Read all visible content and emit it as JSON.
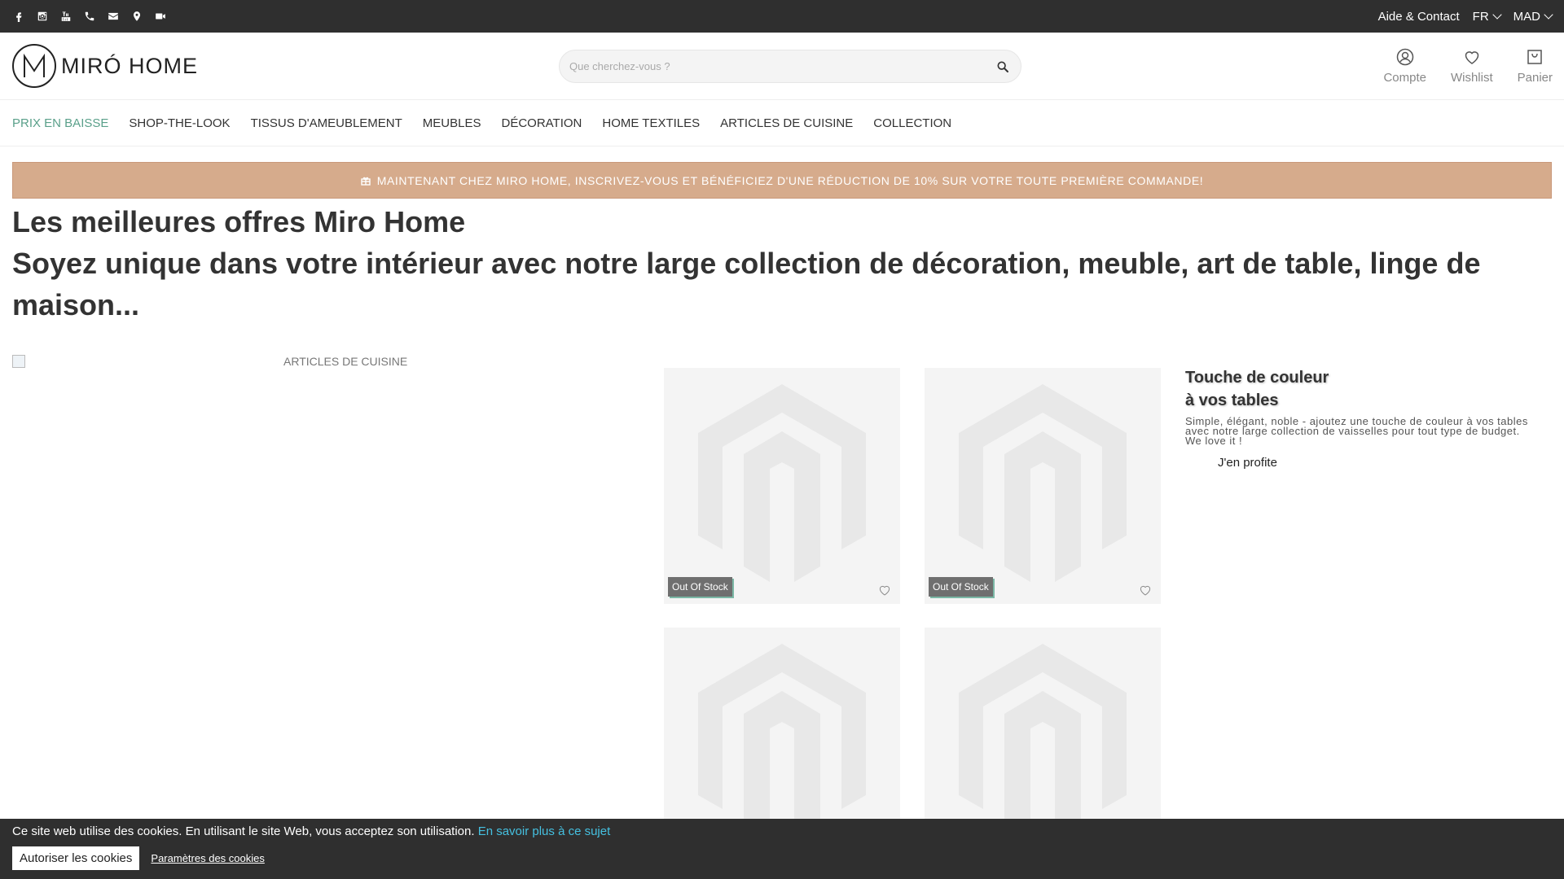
{
  "topbar": {
    "social_icons": [
      "facebook-icon",
      "instagram-icon",
      "youtube-icon",
      "phone-icon",
      "mail-icon",
      "map-pin-icon",
      "video-icon"
    ],
    "help_label": "Aide & Contact",
    "language": "FR",
    "currency": "MAD"
  },
  "header": {
    "logo_text": "MIRÓ HOME",
    "search_placeholder": "Que cherchez-vous ?",
    "account_label": "Compte",
    "wishlist_label": "Wishlist",
    "cart_label": "Panier"
  },
  "nav": {
    "items": [
      {
        "label": "PRIX EN BAISSE"
      },
      {
        "label": "SHOP-THE-LOOK"
      },
      {
        "label": "TISSUS D'AMEUBLEMENT"
      },
      {
        "label": "MEUBLES"
      },
      {
        "label": "DÉCORATION"
      },
      {
        "label": "HOME TEXTILES"
      },
      {
        "label": "ARTICLES DE CUISINE"
      },
      {
        "label": "COLLECTION"
      }
    ],
    "active_color": "#5aa08a"
  },
  "promo": {
    "text": "MAINTENANT CHEZ MIRO HOME, INSCRIVEZ-VOUS ET BÉNÉFICIEZ D'UNE RÉDUCTION DE 10% SUR VOTRE TOUTE PREMIÈRE COMMANDE!",
    "background": "#d6ab8c"
  },
  "headline": {
    "title": "Les meilleures offres Miro Home",
    "subtitle": "Soyez unique dans votre intérieur avec notre large collection de décoration, meuble, art de table, linge de maison..."
  },
  "content": {
    "banner_alt": "ARTICLES DE CUISINE",
    "products": [
      {
        "badge": "Out Of Stock"
      },
      {
        "badge": "Out Of Stock"
      },
      {
        "badge": ""
      },
      {
        "badge": ""
      }
    ],
    "promo_title_line1": "Touche de couleur",
    "promo_title_line2": "à vos tables",
    "promo_desc": "Simple, élégant, noble - ajoutez une touche de couleur à vos tables avec notre large collection de vaisselles pour tout type de budget. We love it !",
    "promo_cta": "J'en profite"
  },
  "cookie": {
    "message": "Ce site web utilise des cookies. En utilisant le site Web, vous acceptez son utilisation.",
    "learn_more": "En savoir plus à ce sujet",
    "allow_label": "Autoriser les cookies",
    "settings_label": "Paramètres des cookies"
  }
}
